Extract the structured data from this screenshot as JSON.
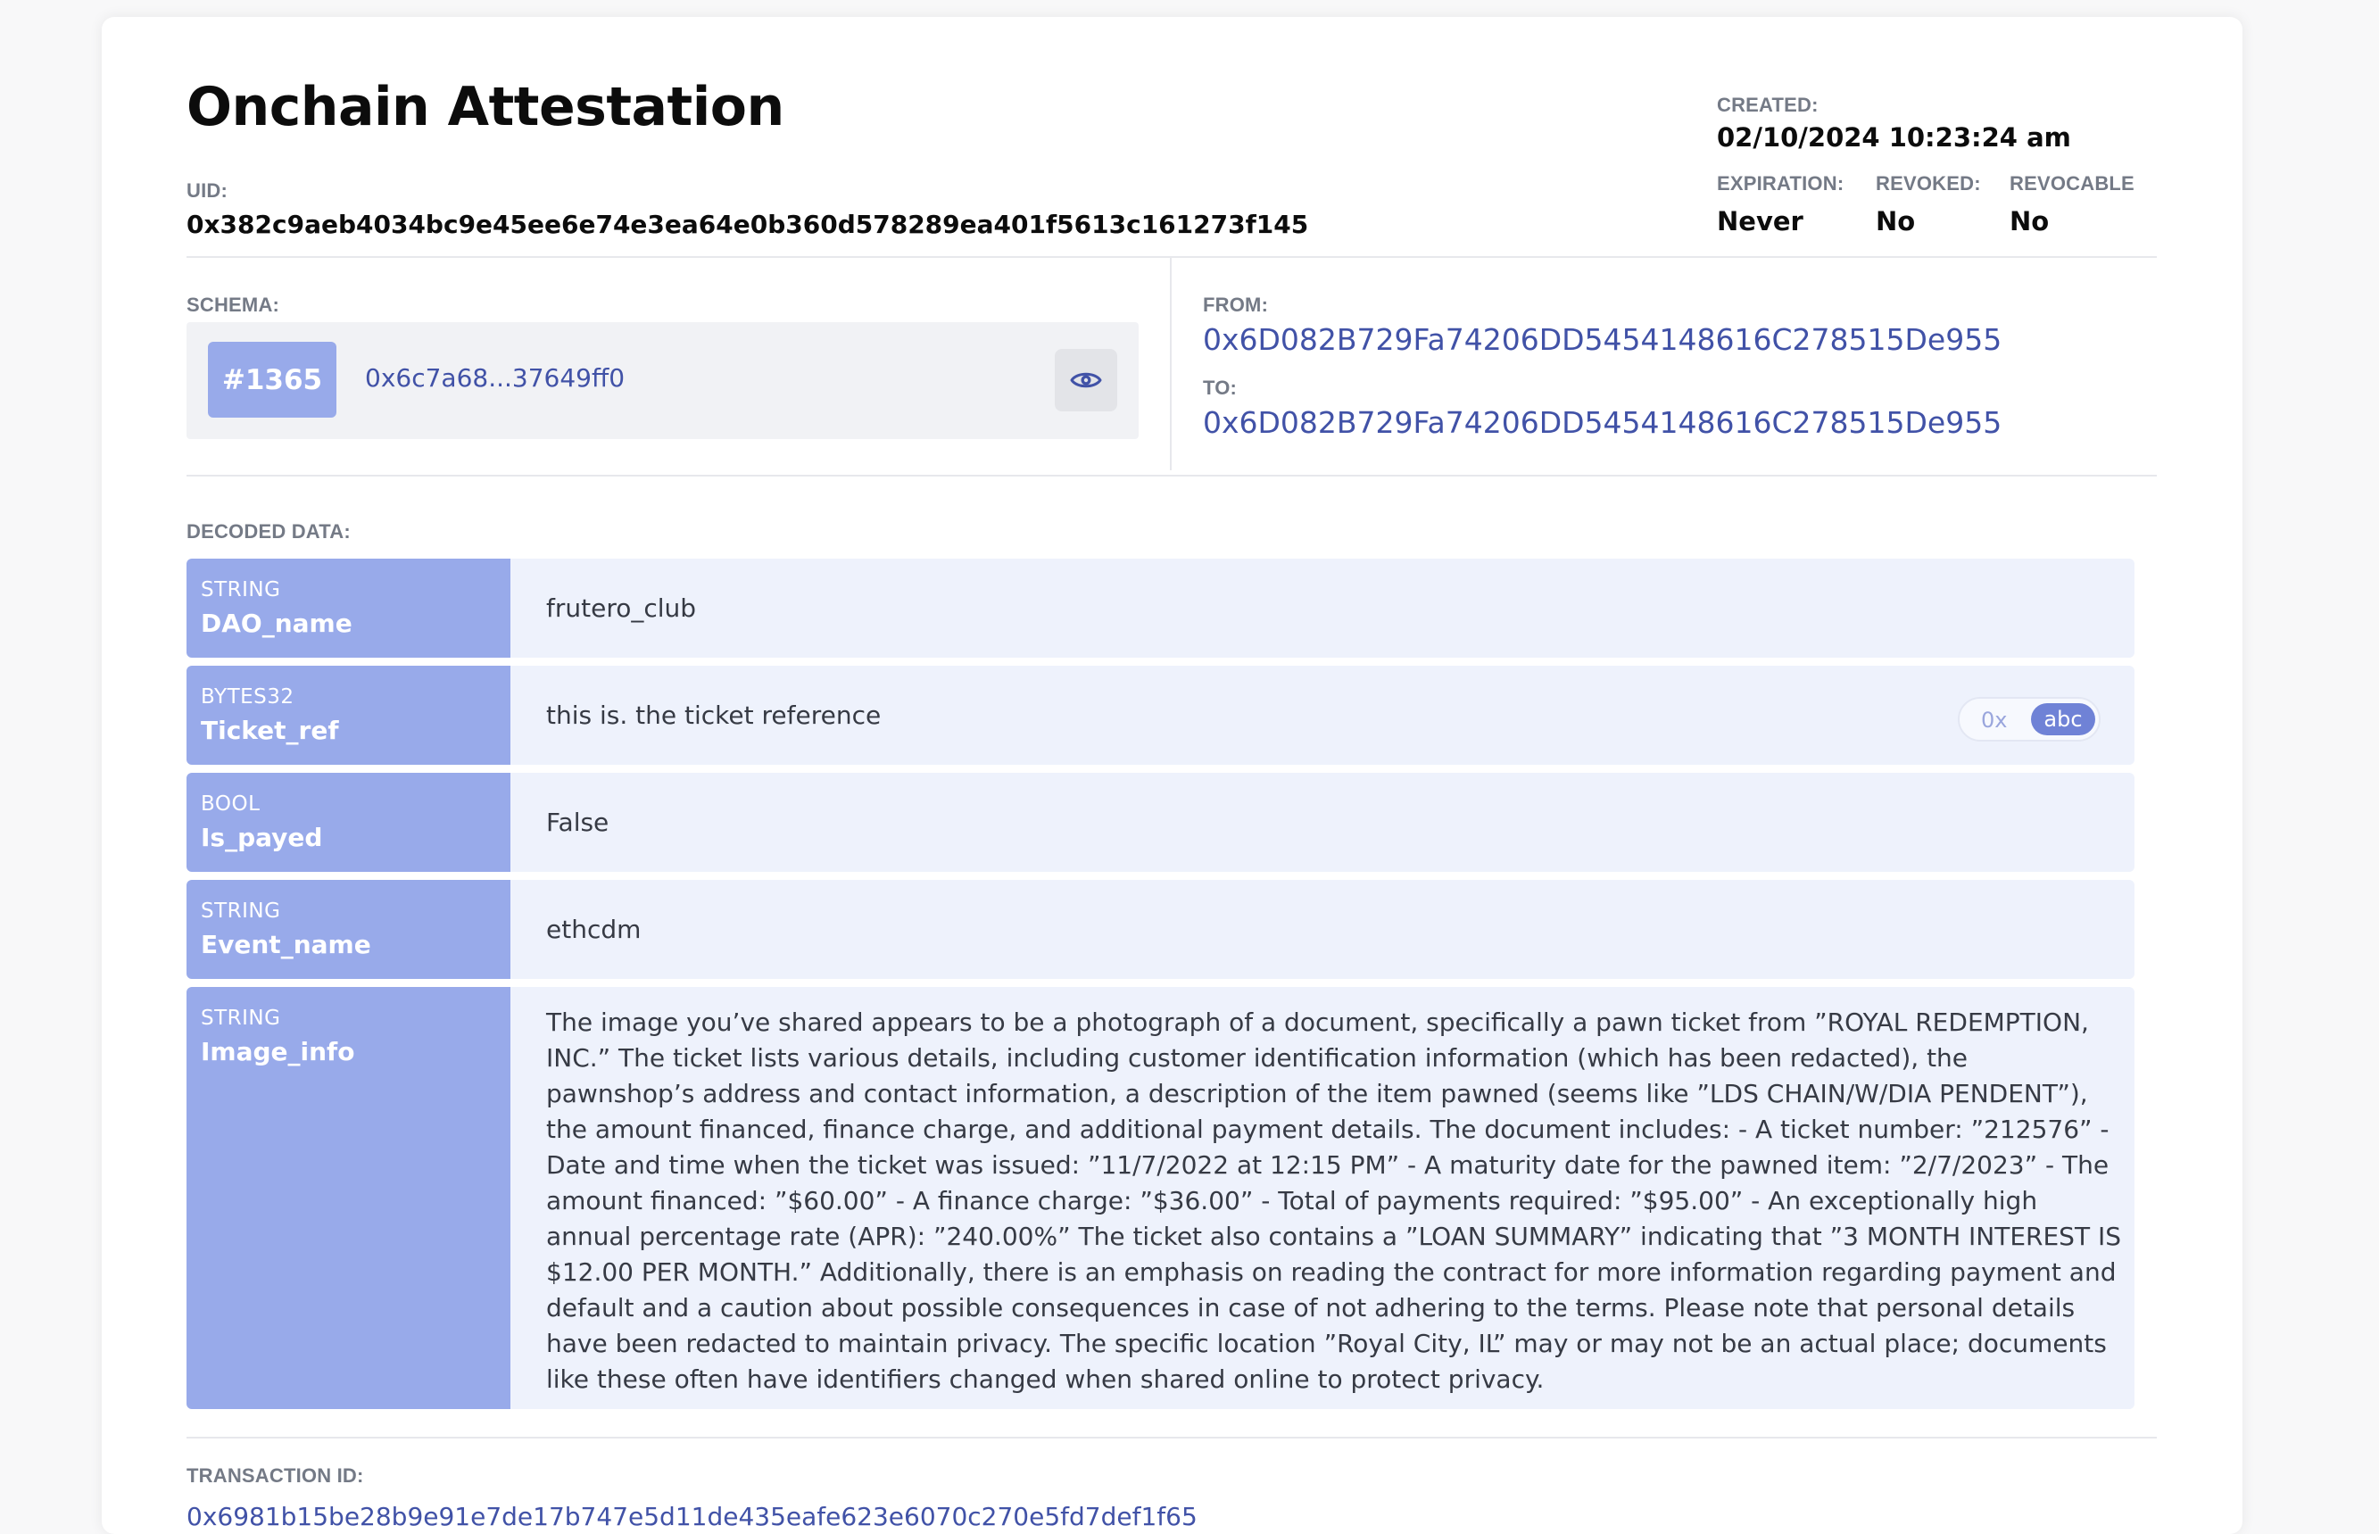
{
  "header": {
    "title": "Onchain Attestation",
    "uid_label": "UID:",
    "uid": "0x382c9aeb4034bc9e45ee6e74e3ea64e0b360d578289ea401f5613c161273f145"
  },
  "meta": {
    "created_label": "CREATED:",
    "created": "02/10/2024 10:23:24 am",
    "expiration_label": "EXPIRATION:",
    "expiration": "Never",
    "revoked_label": "REVOKED:",
    "revoked": "No",
    "revocable_label": "REVOCABLE",
    "revocable": "No"
  },
  "schema": {
    "label": "SCHEMA:",
    "id": "#1365",
    "address": "0x6c7a68...37649ff0",
    "view_icon": "eye-icon"
  },
  "parties": {
    "from_label": "FROM:",
    "from": "0x6D082B729Fa74206DD5454148616C278515De955",
    "to_label": "TO:",
    "to": "0x6D082B729Fa74206DD5454148616C278515De955"
  },
  "decoded": {
    "label": "DECODED DATA:",
    "rows": [
      {
        "type": "STRING",
        "name": "DAO_name",
        "value": "frutero_club"
      },
      {
        "type": "BYTES32",
        "name": "Ticket_ref",
        "value": "this is. the ticket reference",
        "toggle": {
          "hex": "0x",
          "text": "abc",
          "selected": "abc"
        }
      },
      {
        "type": "BOOL",
        "name": "Is_payed",
        "value": "False"
      },
      {
        "type": "STRING",
        "name": "Event_name",
        "value": "ethcdm"
      },
      {
        "type": "STRING",
        "name": "Image_info",
        "value": "The image you’ve shared appears to be a photograph of a document, specifically a pawn ticket from ”ROYAL REDEMPTION, INC.” The ticket lists various details, including customer identification information (which has been redacted), the pawnshop’s address and contact information, a description of the item pawned (seems like ”LDS CHAIN/W/DIA PENDENT”), the amount financed, finance charge, and additional payment details. The document includes: - A ticket number: ”212576” - Date and time when the ticket was issued: ”11/7/2022 at 12:15 PM” - A maturity date for the pawned item: ”2/7/2023” - The amount financed: ”$60.00” - A finance charge: ”$36.00” - Total of payments required: ”$95.00” - An exceptionally high annual percentage rate (APR): ”240.00%” The ticket also contains a ”LOAN SUMMARY” indicating that ”3 MONTH INTEREST IS $12.00 PER MONTH.” Additionally, there is an emphasis on reading the contract for more information regarding payment and default and a caution about possible consequences in case of not adhering to the terms. Please note that personal details have been redacted to maintain privacy. The specific location ”Royal City, IL” may or may not be an actual place; documents like these often have identifiers changed when shared online to protect privacy."
      }
    ]
  },
  "transaction": {
    "label": "TRANSACTION ID:",
    "id": "0x6981b15be28b9e91e7de17b747e5d11de435eafe623e6070c270e5fd7def1f65"
  },
  "colors": {
    "accent": "#98aaea",
    "link": "#4152a7",
    "row_bg": "#eef2fc"
  }
}
